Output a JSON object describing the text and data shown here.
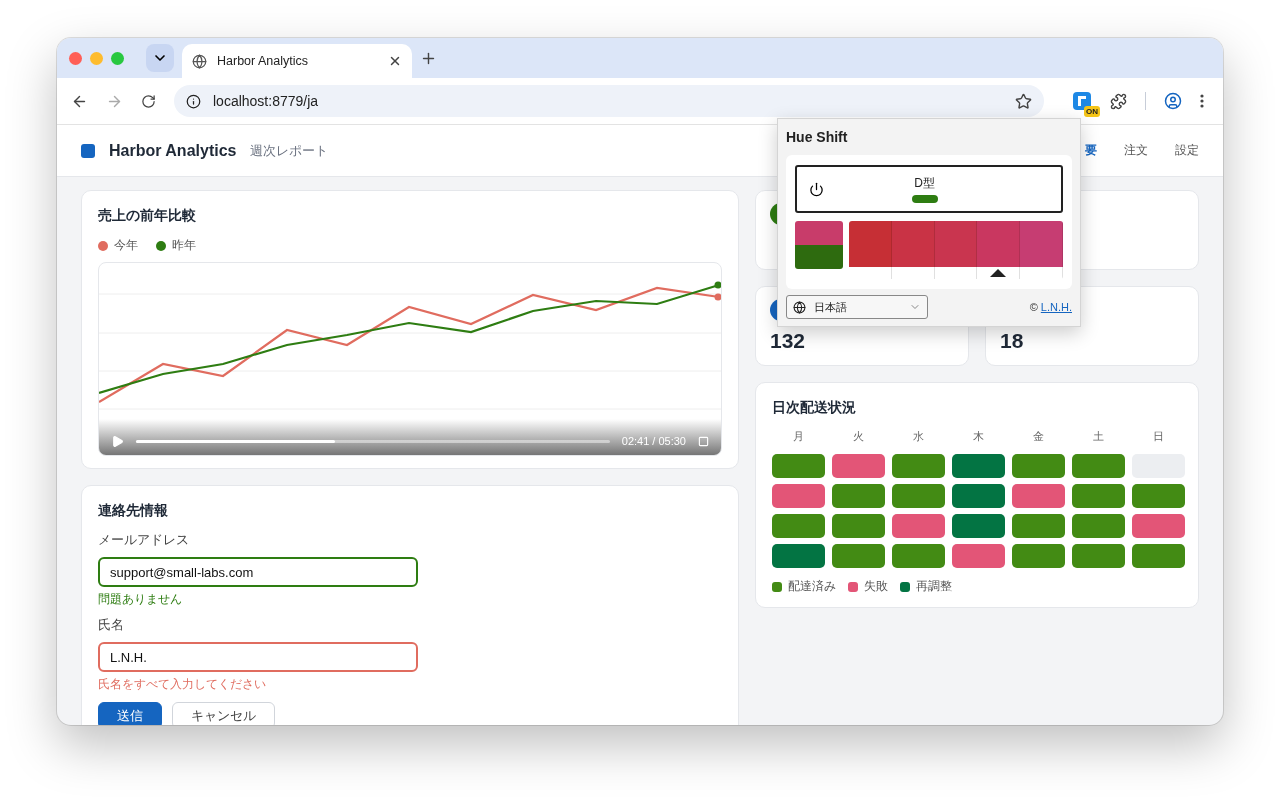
{
  "browser": {
    "tab": {
      "title": "Harbor Analytics",
      "selected": true
    },
    "url": "localhost:8779/ja",
    "extension_badge": "ON"
  },
  "header": {
    "brand": "Harbor Analytics",
    "subtitle": "週次レポート",
    "nav": [
      {
        "label": "要",
        "selected": true
      },
      {
        "label": "注文",
        "selected": false
      },
      {
        "label": "設定",
        "selected": false
      }
    ]
  },
  "sales_card": {
    "title": "売上の前年比較",
    "legend": [
      {
        "label": "今年",
        "color": "#e06c5f"
      },
      {
        "label": "昨年",
        "color": "#2e7d12"
      }
    ],
    "player": {
      "level": 0.42,
      "time": "02:41 / 05:30"
    }
  },
  "contact_form": {
    "title": "連絡先情報",
    "fields": [
      {
        "label": "メールアドレス",
        "value": "support@small-labs.com",
        "kind": "valid",
        "message": "問題ありません"
      },
      {
        "label": "氏名",
        "value": "L.N.H.",
        "kind": "invalid",
        "message": "氏名をすべて入力してください"
      }
    ],
    "buttons": [
      {
        "label": "送信",
        "kind": "primary"
      },
      {
        "label": "キャンセル",
        "kind": "secondary"
      }
    ]
  },
  "stats": [
    {
      "kind": "stat",
      "color": "#2e7d12"
    },
    {
      "kind": "covered"
    },
    {
      "kind": "stat",
      "value": "132",
      "color": "#1565c0"
    },
    {
      "kind": "stat",
      "value": "18"
    }
  ],
  "delivery": {
    "title": "日次配送状況",
    "days": [
      "月",
      "火",
      "水",
      "木",
      "金",
      "土",
      "日"
    ],
    "rows": [
      [
        {
          "kind": "delivered"
        },
        {
          "kind": "failed"
        },
        {
          "kind": "delivered"
        },
        {
          "kind": "rescheduled"
        },
        {
          "kind": "delivered"
        },
        {
          "kind": "delivered"
        },
        {
          "kind": "empty"
        }
      ],
      [
        {
          "kind": "failed"
        },
        {
          "kind": "delivered"
        },
        {
          "kind": "delivered"
        },
        {
          "kind": "rescheduled"
        },
        {
          "kind": "failed"
        },
        {
          "kind": "delivered"
        },
        {
          "kind": "delivered"
        }
      ],
      [
        {
          "kind": "delivered"
        },
        {
          "kind": "delivered"
        },
        {
          "kind": "failed"
        },
        {
          "kind": "rescheduled"
        },
        {
          "kind": "delivered"
        },
        {
          "kind": "delivered"
        },
        {
          "kind": "failed"
        }
      ],
      [
        {
          "kind": "rescheduled"
        },
        {
          "kind": "delivered"
        },
        {
          "kind": "delivered"
        },
        {
          "kind": "failed"
        },
        {
          "kind": "delivered"
        },
        {
          "kind": "delivered"
        },
        {
          "kind": "delivered"
        }
      ]
    ],
    "legend": [
      {
        "kind": "delivered",
        "label": "配達済み",
        "color": "#438b14"
      },
      {
        "kind": "failed",
        "label": "失敗",
        "color": "#e35577"
      },
      {
        "kind": "rescheduled",
        "label": "再調整",
        "color": "#037443"
      }
    ]
  },
  "hue_shift": {
    "title": "Hue Shift",
    "mode": "D型",
    "palette": [
      {
        "color": "#c62f35",
        "selected": false
      },
      {
        "color": "#c93345",
        "selected": false
      },
      {
        "color": "#c9354f",
        "selected": false
      },
      {
        "color": "#c93760",
        "selected": true
      },
      {
        "color": "#c63d72",
        "selected": false
      }
    ],
    "language": "日本語",
    "credit_symbol": "©",
    "credit_link": "L.N.H."
  }
}
